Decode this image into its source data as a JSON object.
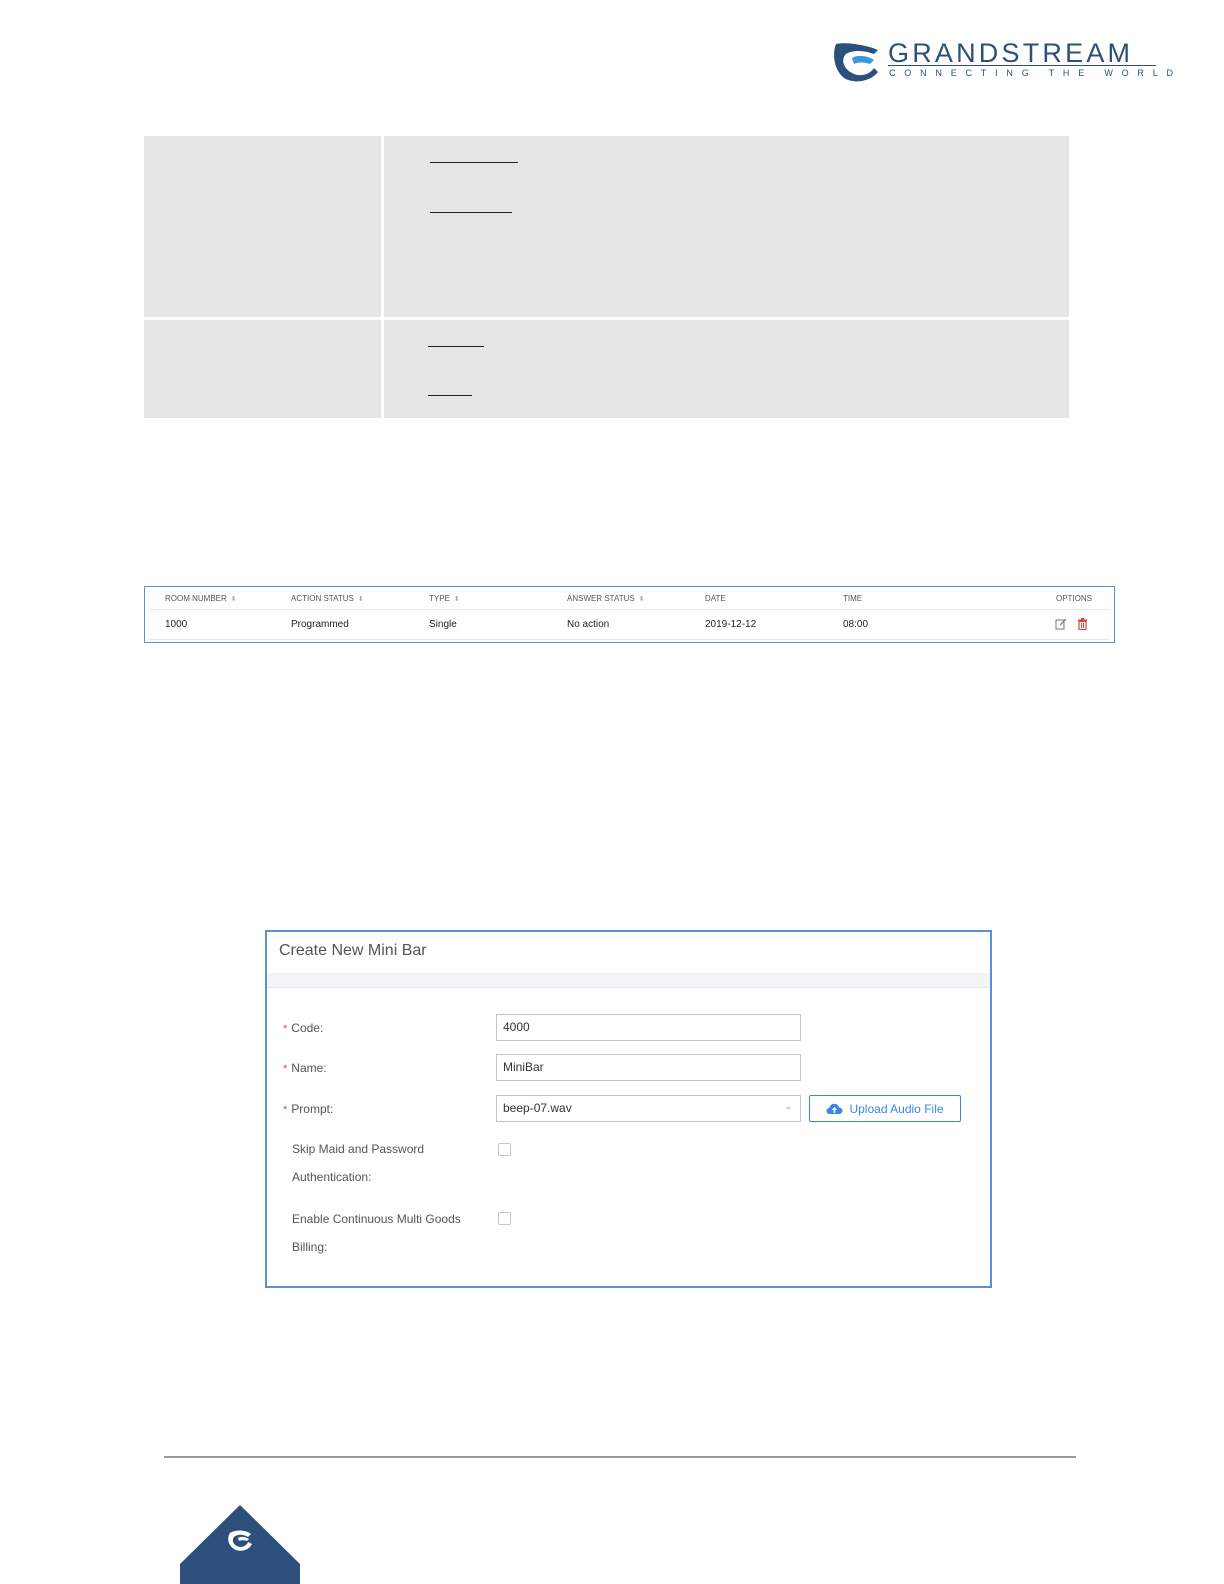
{
  "brand": {
    "name": "GRANDSTREAM",
    "tagline": "CONNECTING THE WORLD",
    "color": "#2c4f7c"
  },
  "room_table": {
    "headers": [
      "ROOM NUMBER",
      "ACTION STATUS",
      "TYPE",
      "ANSWER STATUS",
      "DATE",
      "TIME",
      "OPTIONS"
    ],
    "sort_icon": "sort-icon",
    "row": {
      "room_number": "1000",
      "action_status": "Programmed",
      "type": "Single",
      "answer_status": "No action",
      "date": "2019-12-12",
      "time": "08:00"
    },
    "edit_icon": "edit-icon",
    "delete_icon": "trash-icon"
  },
  "minibar_dialog": {
    "title": "Create New Mini Bar",
    "fields": {
      "code_label": "Code",
      "code_value": "4000",
      "name_label": "Name",
      "name_value": "MiniBar",
      "prompt_label": "Prompt",
      "prompt_value": "beep-07.wav",
      "skip_label_1": "Skip Maid and Password",
      "skip_label_2": "Authentication",
      "billing_label_1": "Enable Continuous Multi Goods",
      "billing_label_2": "Billing"
    },
    "colon": ":",
    "upload_label": "Upload Audio File",
    "accent": "#3a86e8",
    "required_color": "#e0463c"
  }
}
